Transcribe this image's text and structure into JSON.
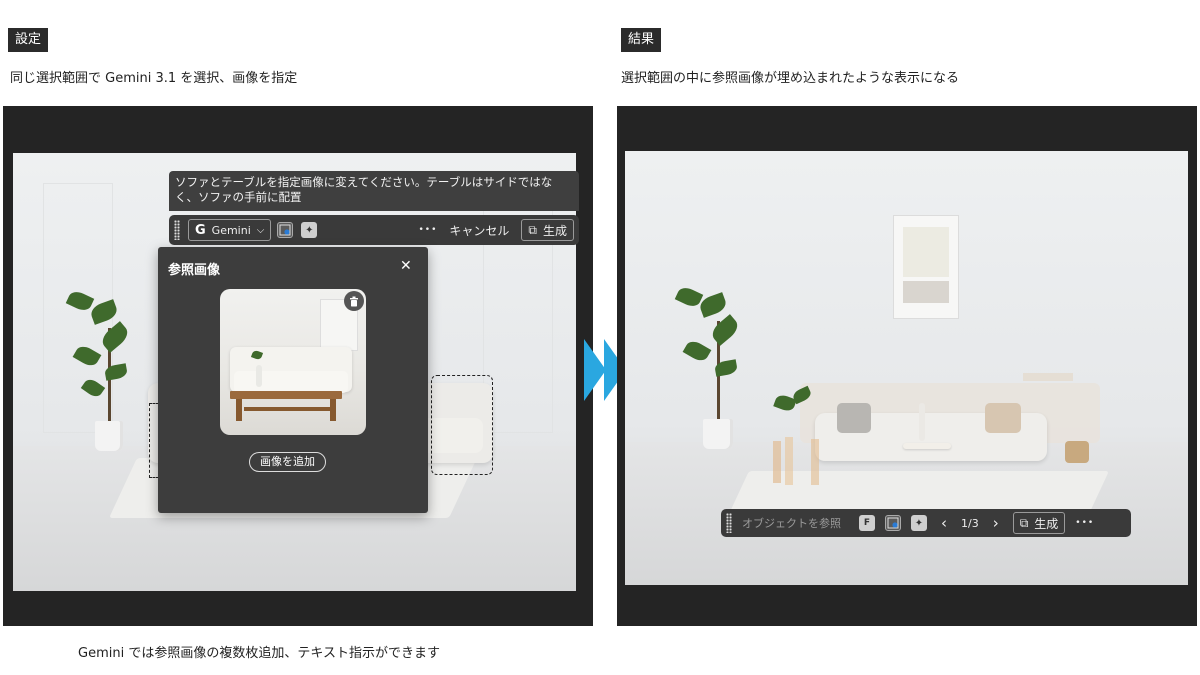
{
  "left": {
    "tag": "設定",
    "caption": "同じ選択範囲で Gemini 3.1 を選択、画像を指定",
    "bottom_caption": "Gemini では参照画像の複数枚追加、テキスト指示ができます",
    "prompt_text": "ソファとテーブルを指定画像に変えてください。テーブルはサイドではなく、ソファの手前に配置",
    "toolbar": {
      "model_label": "Gemini",
      "more_label": "•••",
      "cancel_label": "キャンセル",
      "generate_label": "生成"
    },
    "ref_panel": {
      "title": "参照画像",
      "close_label": "✕",
      "add_button_label": "画像を追加"
    }
  },
  "right": {
    "tag": "結果",
    "caption": "選択範囲の中に参照画像が埋め込まれたような表示になる",
    "toolbar": {
      "placeholder": "オブジェクトを参照",
      "prev_label": "‹",
      "page_label": "1/3",
      "next_label": "›",
      "generate_label": "生成",
      "more_label": "•••"
    }
  },
  "colors": {
    "arrow": "#2aa7e0",
    "panel_dark": "#242424",
    "toolbar": "#3a3a3a"
  },
  "icons": [
    "google-g-icon",
    "chevron-down-icon",
    "reference-image-icon",
    "object-icon",
    "generate-icon",
    "trash-icon",
    "close-icon",
    "text-icon"
  ]
}
